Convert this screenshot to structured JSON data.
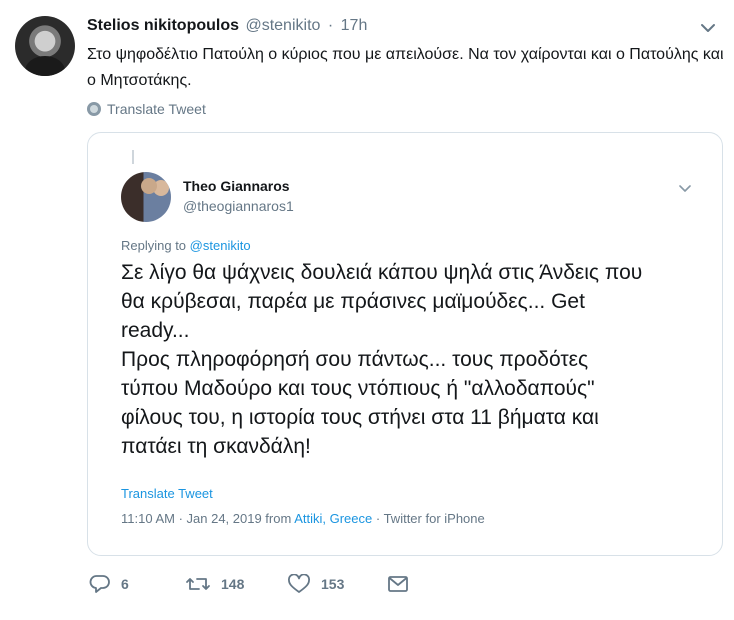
{
  "author": {
    "name": "Stelios nikitopoulos",
    "handle": "@stenikito",
    "separator": "·",
    "time": "17h"
  },
  "tweet": {
    "text": "Στο ψηφοδέλτιο Πατούλη ο κύριος που με απειλούσε. Να τον χαίρονται και ο Πατούλης και ο Μητσοτάκης.",
    "translate_label": "Translate Tweet"
  },
  "quoted": {
    "name": "Theo Giannaros",
    "handle": "@theogiannaros1",
    "replying_prefix": "Replying to",
    "replying_handle": "@stenikito",
    "text_lines": [
      "Σε λίγο θα ψάχνεις δουλειά κάπου ψηλά στις Άνδεις που",
      "θα κρύβεσαι, παρέα με πράσινες μαϊμούδες... Get",
      "ready...",
      "Προς πληροφόρησή σου πάντως... τους προδότες",
      "τύπου Μαδούρο και τους ντόπιους ή \"αλλοδαπούς\"",
      "φίλους του, η ιστορία τους στήνει στα 11 βήματα και",
      "πατάει τη σκανδάλη!"
    ],
    "translate_label": "Translate Tweet",
    "meta_time": "11:10 AM · Jan 24, 2019 from",
    "meta_location": "Attiki, Greece",
    "meta_source": "· Twitter for iPhone"
  },
  "actions": {
    "replies": "6",
    "retweets": "148",
    "likes": "153"
  },
  "colors": {
    "accent": "#1b95e0",
    "muted": "#657786",
    "border": "#d8e1e8"
  },
  "icons": [
    "avatar",
    "chevron-down-icon",
    "globe-icon",
    "reply-icon",
    "retweet-icon",
    "like-icon",
    "message-icon"
  ]
}
